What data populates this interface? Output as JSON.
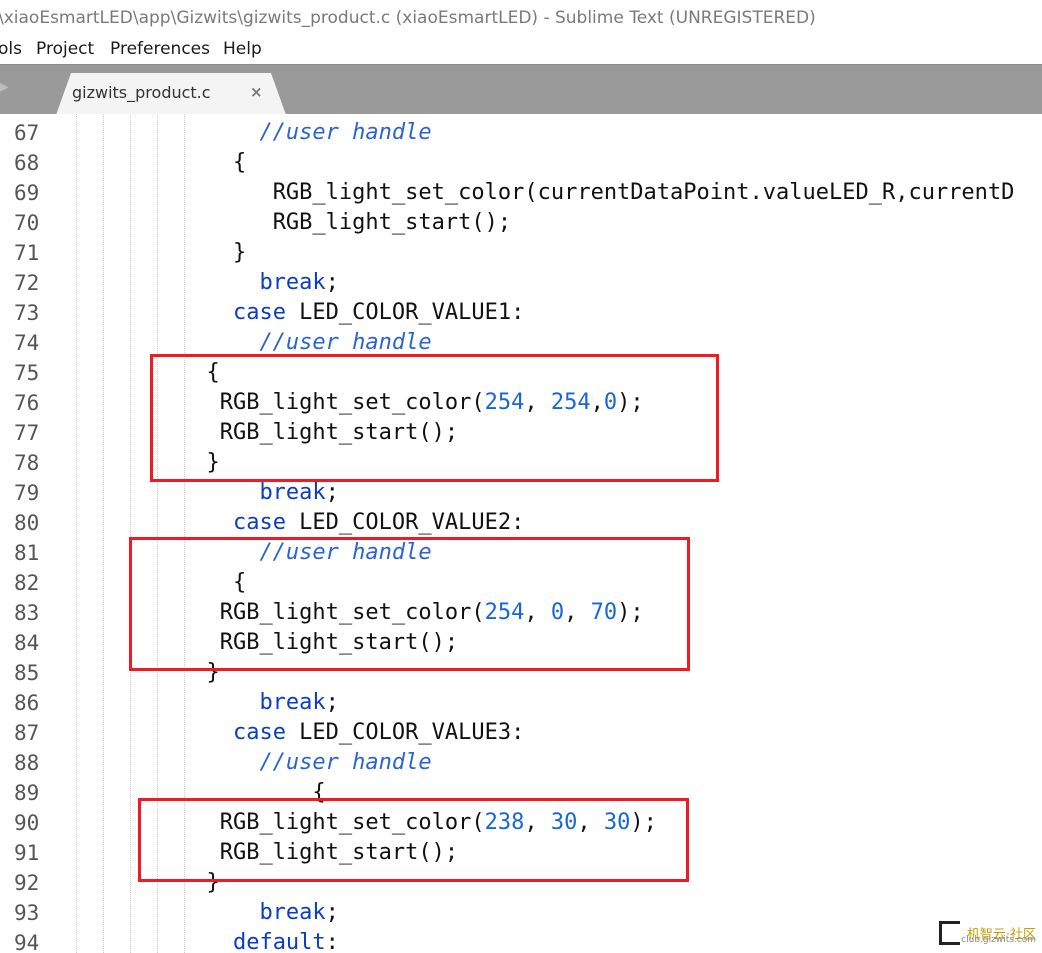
{
  "window": {
    "title": "\\xiaoEsmartLED\\app\\Gizwits\\gizwits_product.c (xiaoEsmartLED) - Sublime Text (UNREGISTERED)"
  },
  "menu": [
    "ols",
    "Project",
    "Preferences",
    "Help"
  ],
  "tab": {
    "label": "gizwits_product.c",
    "close": "×",
    "arrow": "▶"
  },
  "colors": {
    "keyword": "#0b3cc8",
    "comment": "#2a62d8",
    "number": "#1766d8",
    "highlight_box": "#ee1b24"
  },
  "code": [
    {
      "n": "67",
      "segs": [
        [
          "sp",
          "              "
        ],
        [
          "cm",
          "//user handle"
        ]
      ]
    },
    {
      "n": "68",
      "segs": [
        [
          "sp",
          "            "
        ],
        [
          "tx",
          "{"
        ]
      ]
    },
    {
      "n": "69",
      "segs": [
        [
          "sp",
          "               "
        ],
        [
          "tx",
          "RGB_light_set_color(currentDataPoint.valueLED_R,currentD"
        ]
      ]
    },
    {
      "n": "70",
      "segs": [
        [
          "sp",
          "               "
        ],
        [
          "tx",
          "RGB_light_start();"
        ]
      ]
    },
    {
      "n": "71",
      "segs": [
        [
          "sp",
          "            "
        ],
        [
          "tx",
          "}"
        ]
      ]
    },
    {
      "n": "72",
      "segs": [
        [
          "sp",
          "              "
        ],
        [
          "kw",
          "break"
        ],
        [
          "tx",
          ";"
        ]
      ]
    },
    {
      "n": "73",
      "segs": [
        [
          "sp",
          "            "
        ],
        [
          "kw",
          "case"
        ],
        [
          "tx",
          " LED_COLOR_VALUE1:"
        ]
      ]
    },
    {
      "n": "74",
      "segs": [
        [
          "sp",
          "              "
        ],
        [
          "cm",
          "//user handle"
        ]
      ]
    },
    {
      "n": "75",
      "segs": [
        [
          "sp",
          "          "
        ],
        [
          "tx",
          "{"
        ]
      ]
    },
    {
      "n": "76",
      "segs": [
        [
          "sp",
          "           "
        ],
        [
          "tx",
          "RGB_light_set_color("
        ],
        [
          "num",
          "254"
        ],
        [
          "tx",
          ", "
        ],
        [
          "num",
          "254"
        ],
        [
          "tx",
          ","
        ],
        [
          "num",
          "0"
        ],
        [
          "tx",
          ");"
        ]
      ]
    },
    {
      "n": "77",
      "segs": [
        [
          "sp",
          "           "
        ],
        [
          "tx",
          "RGB_light_start();"
        ]
      ]
    },
    {
      "n": "78",
      "segs": [
        [
          "sp",
          "          "
        ],
        [
          "tx",
          "}"
        ]
      ]
    },
    {
      "n": "79",
      "segs": [
        [
          "sp",
          "              "
        ],
        [
          "kw",
          "break"
        ],
        [
          "tx",
          ";"
        ]
      ]
    },
    {
      "n": "80",
      "segs": [
        [
          "sp",
          "            "
        ],
        [
          "kw",
          "case"
        ],
        [
          "tx",
          " LED_COLOR_VALUE2:"
        ]
      ]
    },
    {
      "n": "81",
      "segs": [
        [
          "sp",
          "              "
        ],
        [
          "cm",
          "//user handle"
        ]
      ]
    },
    {
      "n": "82",
      "segs": [
        [
          "sp",
          "            "
        ],
        [
          "tx",
          "{"
        ]
      ]
    },
    {
      "n": "83",
      "segs": [
        [
          "sp",
          "           "
        ],
        [
          "tx",
          "RGB_light_set_color("
        ],
        [
          "num",
          "254"
        ],
        [
          "tx",
          ", "
        ],
        [
          "num",
          "0"
        ],
        [
          "tx",
          ", "
        ],
        [
          "num",
          "70"
        ],
        [
          "tx",
          ");"
        ]
      ]
    },
    {
      "n": "84",
      "segs": [
        [
          "sp",
          "           "
        ],
        [
          "tx",
          "RGB_light_start();"
        ]
      ]
    },
    {
      "n": "85",
      "segs": [
        [
          "sp",
          "          "
        ],
        [
          "tx",
          "}"
        ]
      ]
    },
    {
      "n": "86",
      "segs": [
        [
          "sp",
          "              "
        ],
        [
          "kw",
          "break"
        ],
        [
          "tx",
          ";"
        ]
      ]
    },
    {
      "n": "87",
      "segs": [
        [
          "sp",
          "            "
        ],
        [
          "kw",
          "case"
        ],
        [
          "tx",
          " LED_COLOR_VALUE3:"
        ]
      ]
    },
    {
      "n": "88",
      "segs": [
        [
          "sp",
          "              "
        ],
        [
          "cm",
          "//user handle"
        ]
      ]
    },
    {
      "n": "89",
      "segs": [
        [
          "sp",
          "                  "
        ],
        [
          "tx",
          "{"
        ]
      ]
    },
    {
      "n": "90",
      "segs": [
        [
          "sp",
          "           "
        ],
        [
          "tx",
          "RGB_light_set_color("
        ],
        [
          "num",
          "238"
        ],
        [
          "tx",
          ", "
        ],
        [
          "num",
          "30"
        ],
        [
          "tx",
          ", "
        ],
        [
          "num",
          "30"
        ],
        [
          "tx",
          ");"
        ]
      ]
    },
    {
      "n": "91",
      "segs": [
        [
          "sp",
          "           "
        ],
        [
          "tx",
          "RGB_light_start();"
        ]
      ]
    },
    {
      "n": "92",
      "segs": [
        [
          "sp",
          "          "
        ],
        [
          "tx",
          "}"
        ]
      ]
    },
    {
      "n": "93",
      "segs": [
        [
          "sp",
          "              "
        ],
        [
          "kw",
          "break"
        ],
        [
          "tx",
          ";"
        ]
      ]
    },
    {
      "n": "94",
      "segs": [
        [
          "sp",
          "            "
        ],
        [
          "kw",
          "default"
        ],
        [
          "tx",
          ":"
        ]
      ]
    }
  ],
  "watermark": {
    "text": "机智云·社区",
    "sub": "club.gizwits.com"
  }
}
